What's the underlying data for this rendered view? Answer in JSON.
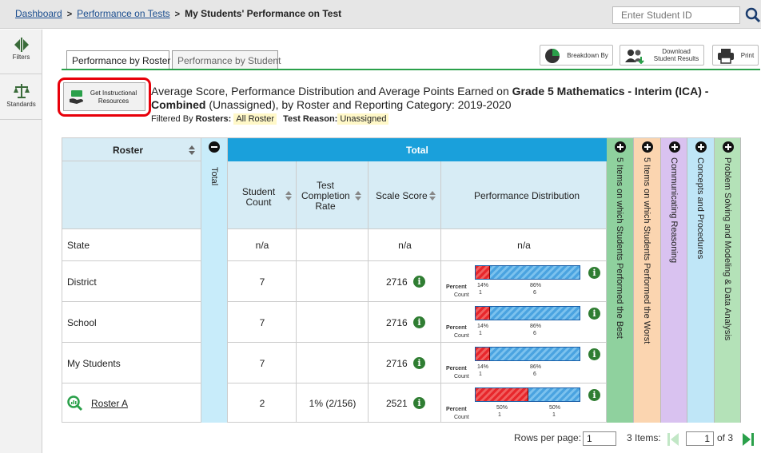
{
  "breadcrumb": {
    "home": "Dashboard",
    "parent": "Performance on Tests",
    "current": "My Students' Performance on Test"
  },
  "search": {
    "placeholder": "Enter Student ID"
  },
  "sidebar": {
    "filters": "Filters",
    "standards": "Standards"
  },
  "tabs": [
    {
      "label": "Performance by Roster"
    },
    {
      "label": "Performance by Student"
    }
  ],
  "toolbar": {
    "breakdown": "Breakdown By",
    "download_line1": "Download",
    "download_line2": "Student Results",
    "print": "Print"
  },
  "resources_button": {
    "line1": "Get Instructional",
    "line2": "Resources"
  },
  "report": {
    "title_pre": "Average Score, Performance Distribution and Average Points Earned on ",
    "title_bold": "Grade 5 Mathematics - Interim (ICA) - Combined",
    "title_post": " (Unassigned), by Roster and Reporting Category: 2019-2020",
    "filter_label": "Filtered By",
    "rosters_label": "Rosters:",
    "rosters_value": "All Roster",
    "reason_label": "Test Reason:",
    "reason_value": "Unassigned"
  },
  "table": {
    "roster_header": "Roster",
    "total_header": "Total",
    "total_side": "Total",
    "columns": {
      "count": "Student Count",
      "completion": "Test Completion Rate",
      "scale": "Scale Score",
      "dist": "Performance Distribution"
    },
    "category_columns": [
      {
        "label": "5 Items on which Students Performed the Best",
        "color": "#8fd19e"
      },
      {
        "label": "5 Items on which Students Performed the Worst",
        "color": "#fbd5b0"
      },
      {
        "label": "Communicating Reasoning",
        "color": "#d9c2f0"
      },
      {
        "label": "Concepts and Procedures",
        "color": "#bfe6f7"
      },
      {
        "label": "Problem Solving and Modeling & Data Analysis",
        "color": "#b4e2b8"
      }
    ],
    "percent_label": "Percent",
    "count_label": "Count",
    "rows": [
      {
        "name": "State",
        "count": "n/a",
        "completion": "",
        "scale": "n/a",
        "dist_text": "n/a"
      },
      {
        "name": "District",
        "count": "7",
        "completion": "",
        "scale": "2716",
        "low_pct": "14%",
        "high_pct": "86%",
        "low_count": "1",
        "high_count": "6",
        "low_frac": 0.14
      },
      {
        "name": "School",
        "count": "7",
        "completion": "",
        "scale": "2716",
        "low_pct": "14%",
        "high_pct": "86%",
        "low_count": "1",
        "high_count": "6",
        "low_frac": 0.14
      },
      {
        "name": "My Students",
        "count": "7",
        "completion": "",
        "scale": "2716",
        "low_pct": "14%",
        "high_pct": "86%",
        "low_count": "1",
        "high_count": "6",
        "low_frac": 0.14
      },
      {
        "name": "Roster A",
        "count": "2",
        "completion": "1% (2/156)",
        "scale": "2521",
        "low_pct": "50%",
        "high_pct": "50%",
        "low_count": "1",
        "high_count": "1",
        "low_frac": 0.5
      }
    ]
  },
  "pagination": {
    "rows_label": "Rows per page:",
    "rows_value": "1",
    "items": "3 Items:",
    "page": "1",
    "of": "of 3"
  },
  "colors": {
    "header_blue": "#1aa0db",
    "light_blue": "#d7ecf5",
    "total_col": "#c8ecfa",
    "green_accent": "#2aa04a",
    "info_green": "#2f7d32",
    "bar_red": "#e8262b",
    "bar_blue": "#4aa3e0"
  }
}
